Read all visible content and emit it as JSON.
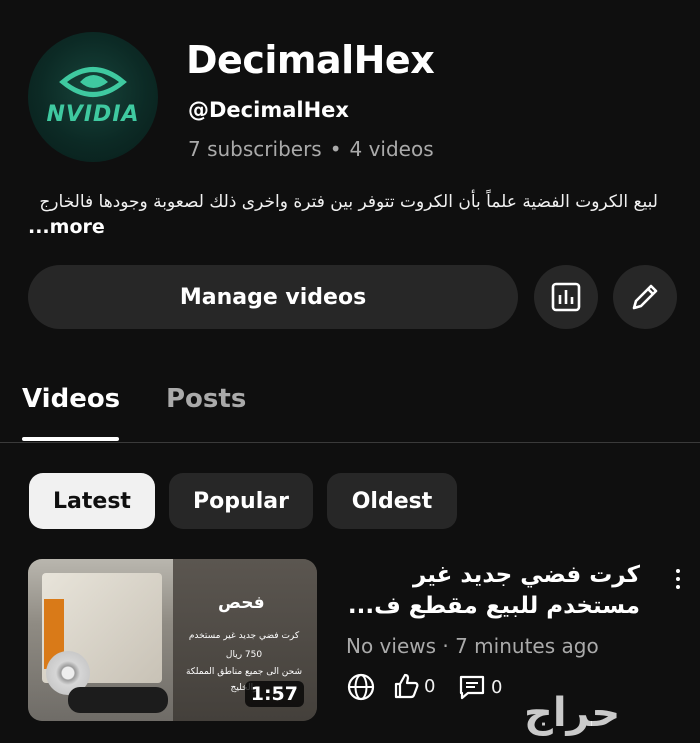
{
  "channel": {
    "avatar_brand": "NVIDIA",
    "name": "DecimalHex",
    "handle": "@DecimalHex",
    "subscribers": "7 subscribers",
    "separator": "•",
    "videos_count": "4 videos",
    "description": "لبيع الكروت الفضية علماً بأن الكروت تتوفر بين فترة واخرى ذلك لصعوبة وجودها فالخارج",
    "more_label": "...more"
  },
  "actions": {
    "manage_label": "Manage videos",
    "stats_icon": "analytics-icon",
    "edit_icon": "pencil-icon"
  },
  "tabs": [
    {
      "label": "Videos",
      "active": true
    },
    {
      "label": "Posts",
      "active": false
    }
  ],
  "chips": [
    {
      "label": "Latest",
      "selected": true
    },
    {
      "label": "Popular",
      "selected": false
    },
    {
      "label": "Oldest",
      "selected": false
    }
  ],
  "video": {
    "title_line1": "كرت فضي جديد غير",
    "title_line2": "مستخدم للبيع مقطع ف...",
    "meta": "No views · 7 minutes ago",
    "duration": "1:57",
    "likes": "0",
    "comments": "0",
    "thumb_text": {
      "title": "فحص",
      "line1": "كرت فضي جديد غير مستخدم",
      "line2": "750 ريال",
      "line3": "شحن الى جميع مناطق المملكة",
      "line4": "والخليج"
    }
  },
  "watermark": "حراج",
  "colors": {
    "background": "#0f0f0f",
    "button_bg": "#272727",
    "secondary_text": "#aaaaaa",
    "nvidia_green": "#3fc9a0"
  }
}
